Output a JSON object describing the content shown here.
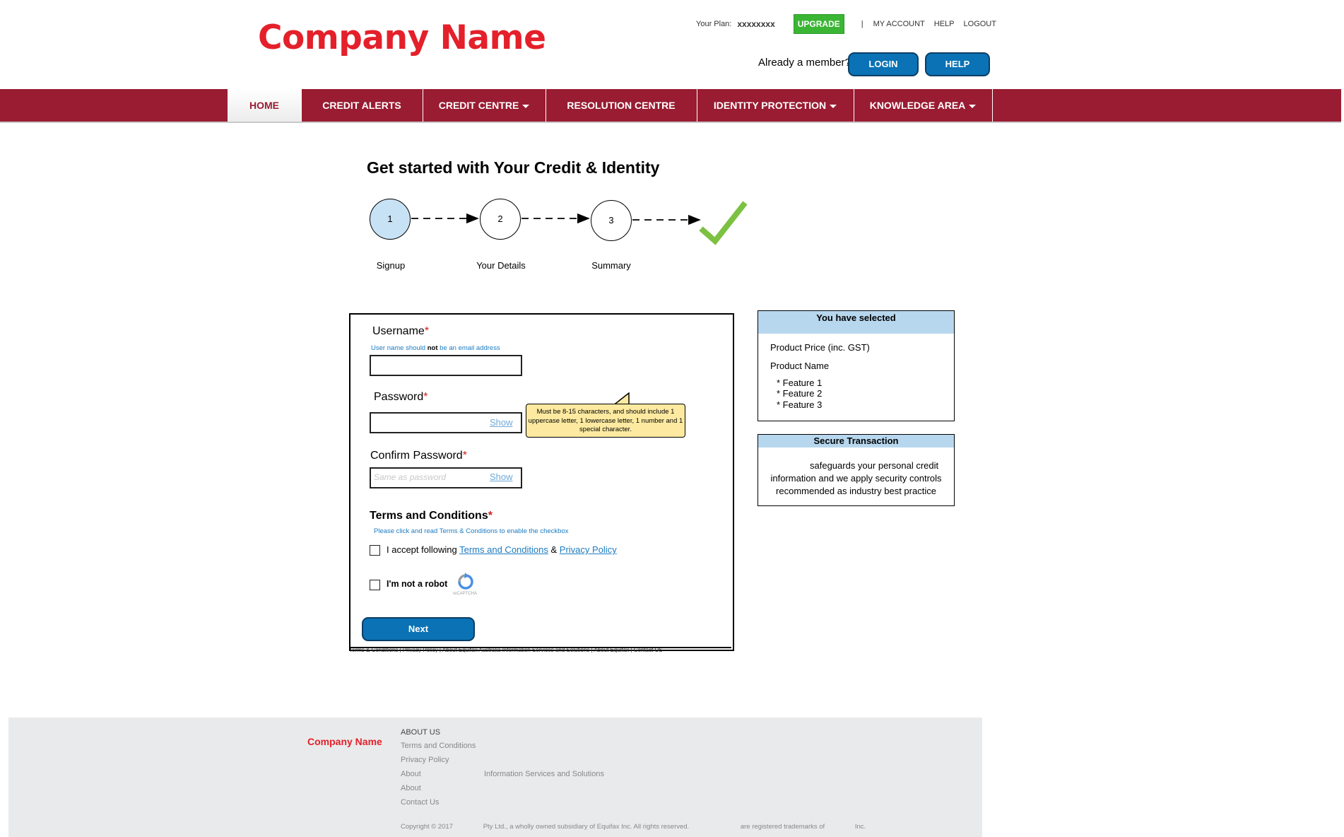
{
  "header": {
    "company_name": "Company Name",
    "plan_label": "Your Plan:",
    "plan_value": "xxxxxxxx",
    "upgrade_label": "UPGRADE",
    "separator": "|",
    "links": [
      "MY ACCOUNT",
      "HELP",
      "LOGOUT"
    ],
    "member_prompt": "Already a member?",
    "login_label": "LOGIN",
    "help_label": "HELP"
  },
  "nav": {
    "items": [
      {
        "label": "HOME"
      },
      {
        "label": "CREDIT ALERTS"
      },
      {
        "label": "CREDIT CENTRE"
      },
      {
        "label": "RESOLUTION CENTRE"
      },
      {
        "label": "IDENTITY PROTECTION"
      },
      {
        "label": "KNOWLEDGE AREA"
      }
    ]
  },
  "main": {
    "title": "Get started with Your Credit & Identity",
    "steps": [
      {
        "number": "1",
        "label": "Signup"
      },
      {
        "number": "2",
        "label": "Your Details"
      },
      {
        "number": "3",
        "label": "Summary"
      }
    ]
  },
  "form": {
    "username_label": "Username",
    "required_mark": "*",
    "username_hint_pre": "User name should ",
    "username_hint_bold": "not",
    "username_hint_post": " be an email address",
    "password_label": "Password",
    "show_label": "Show",
    "password_tooltip": "Must be 8-15 characters, and should include 1 uppercase letter, 1 lowercase letter, 1 number and 1 special character.",
    "confirm_label": "Confirm Password",
    "confirm_placeholder": "Same as password",
    "terms_heading": "Terms and Conditions",
    "terms_hint": "Please click and read Terms & Conditions to enable the checkbox",
    "accept_text": "I accept following",
    "terms_link": "Terms and Conditions",
    "amp": "&",
    "privacy_link": "Privacy Policy",
    "robot_label": "I'm not a robot",
    "recaptcha_text": "reCAPTCHA",
    "next_label": "Next",
    "bottom_links": "Terms & Conditions | Privacy Policy | About Equifax Australia Information Services and Solutions | About Equifax | Contact US"
  },
  "selected_panel": {
    "title": "You have selected",
    "price": "Product Price (inc. GST)",
    "product": "Product Name",
    "features": [
      "* Feature 1",
      "* Feature 2",
      "* Feature 3"
    ]
  },
  "secure_panel": {
    "title": "Secure Transaction",
    "line1": "safeguards your personal credit",
    "line2": "information and we apply security controls",
    "line3": "recommended as industry best practice"
  },
  "footer": {
    "company_name": "Company Name",
    "about_us": "ABOUT US",
    "terms": "Terms and Conditions",
    "privacy": "Privacy Policy",
    "about1": "About",
    "about1_suffix": "Information Services and Solutions",
    "about2": "About",
    "contact": "Contact Us",
    "copyright_pre": "Copyright © 2017",
    "copyright_mid": "Pty Ltd., a wholly owned subsidiary of Equifax Inc. All rights reserved.",
    "copyright_post": "are registered trademarks of",
    "copyright_end": "Inc."
  },
  "colors": {
    "brand_red": "#e4202a",
    "nav_maroon": "#991c32",
    "button_blue": "#0a72b5",
    "upgrade_green": "#3ab534",
    "panel_blue": "#b7d7ee",
    "tooltip_yellow": "#fdeaa0",
    "check_green": "#7cc142"
  }
}
